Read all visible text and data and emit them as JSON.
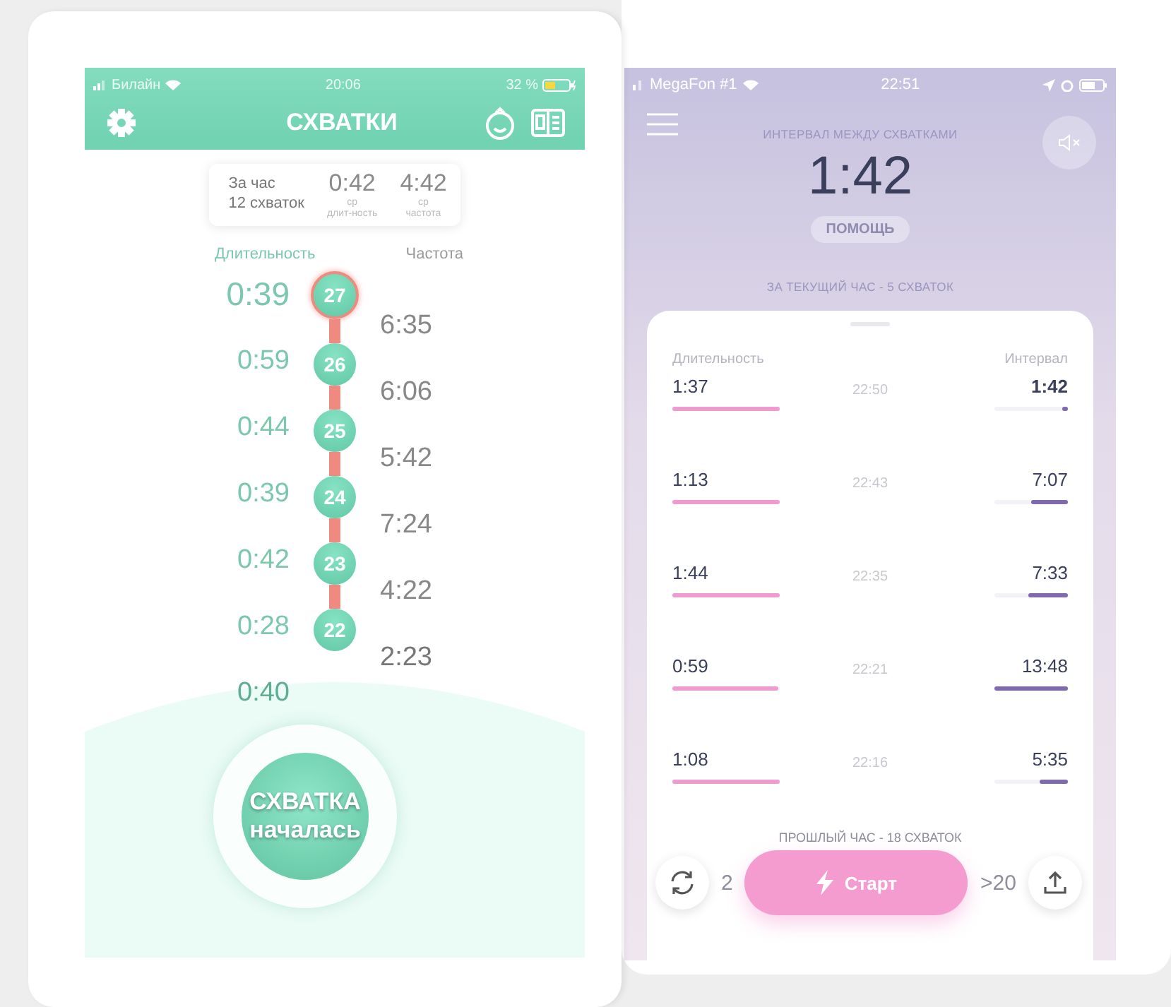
{
  "contraction_timer": {
    "status_bar": {
      "carrier": "Билайн",
      "time": "20:06",
      "battery": "32 %"
    },
    "title": "СХВАТКИ",
    "summary": {
      "period": "За час",
      "count": "12 схваток",
      "avg_duration": "0:42",
      "avg_duration_caption": [
        "ср",
        "длит-ность"
      ],
      "avg_frequency": "4:42",
      "avg_frequency_caption": [
        "ср",
        "частота"
      ]
    },
    "column_headers": [
      {
        "label": "Длительность",
        "selected": true
      },
      {
        "label": "Частота",
        "selected": false
      }
    ],
    "contractions": [
      {
        "number": "27",
        "duration": "0:39",
        "current": true,
        "faded": false
      },
      {
        "number": "26",
        "duration": "0:59",
        "current": false,
        "faded": false
      },
      {
        "number": "25",
        "duration": "0:44",
        "current": false,
        "faded": false
      },
      {
        "number": "24",
        "duration": "0:39",
        "current": false,
        "faded": false
      },
      {
        "number": "23",
        "duration": "0:42",
        "current": false,
        "faded": false
      },
      {
        "number": "22",
        "duration": "0:28",
        "current": false,
        "faded": false
      },
      {
        "duration": "0:40",
        "current": false,
        "faded": true
      }
    ],
    "frequencies": [
      {
        "value": "6:35",
        "faded": false
      },
      {
        "value": "6:06",
        "faded": false
      },
      {
        "value": "5:42",
        "faded": false
      },
      {
        "value": "7:24",
        "faded": false
      },
      {
        "value": "4:22",
        "faded": false
      },
      {
        "value": "2:23",
        "faded": true
      }
    ],
    "start_button": [
      "СХВАТКА",
      "началась"
    ]
  },
  "interval_timer": {
    "status_bar": {
      "carrier": "MegaFon #1",
      "time": "22:51"
    },
    "heading": "ИНТЕРВАЛ МЕЖДУ СХВАТКАМИ",
    "timer": "1:42",
    "help_button": "ПОМОЩЬ",
    "hour_summary": "ЗА ТЕКУЩИЙ ЧАС - 5 СХВАТОК",
    "columns": [
      "Длительность",
      "Интервал"
    ],
    "rows": [
      {
        "duration": {
          "text": "1:37",
          "level": 1
        },
        "time": "22:50",
        "interval": {
          "text": "1:42",
          "level": 0.08
        },
        "latest": true
      },
      {
        "duration": {
          "text": "1:13",
          "level": 1
        },
        "time": "22:43",
        "interval": {
          "text": "7:07",
          "level": 0.5
        },
        "latest": false
      },
      {
        "duration": {
          "text": "1:44",
          "level": 1
        },
        "time": "22:35",
        "interval": {
          "text": "7:33",
          "level": 0.54
        },
        "latest": false
      },
      {
        "duration": {
          "text": "0:59",
          "level": 0.99
        },
        "time": "22:21",
        "interval": {
          "text": "13:48",
          "level": 1
        },
        "latest": false
      },
      {
        "duration": {
          "text": "1:08",
          "level": 1
        },
        "time": "22:16",
        "interval": {
          "text": "5:35",
          "level": 0.38
        },
        "latest": false
      }
    ],
    "previous_hour": "ПРОШЛЫЙ ЧАС - 18 СХВАТОК",
    "column_1_fragment": "2",
    "column_3_fragment": ">20",
    "start_button": "Старт"
  }
}
